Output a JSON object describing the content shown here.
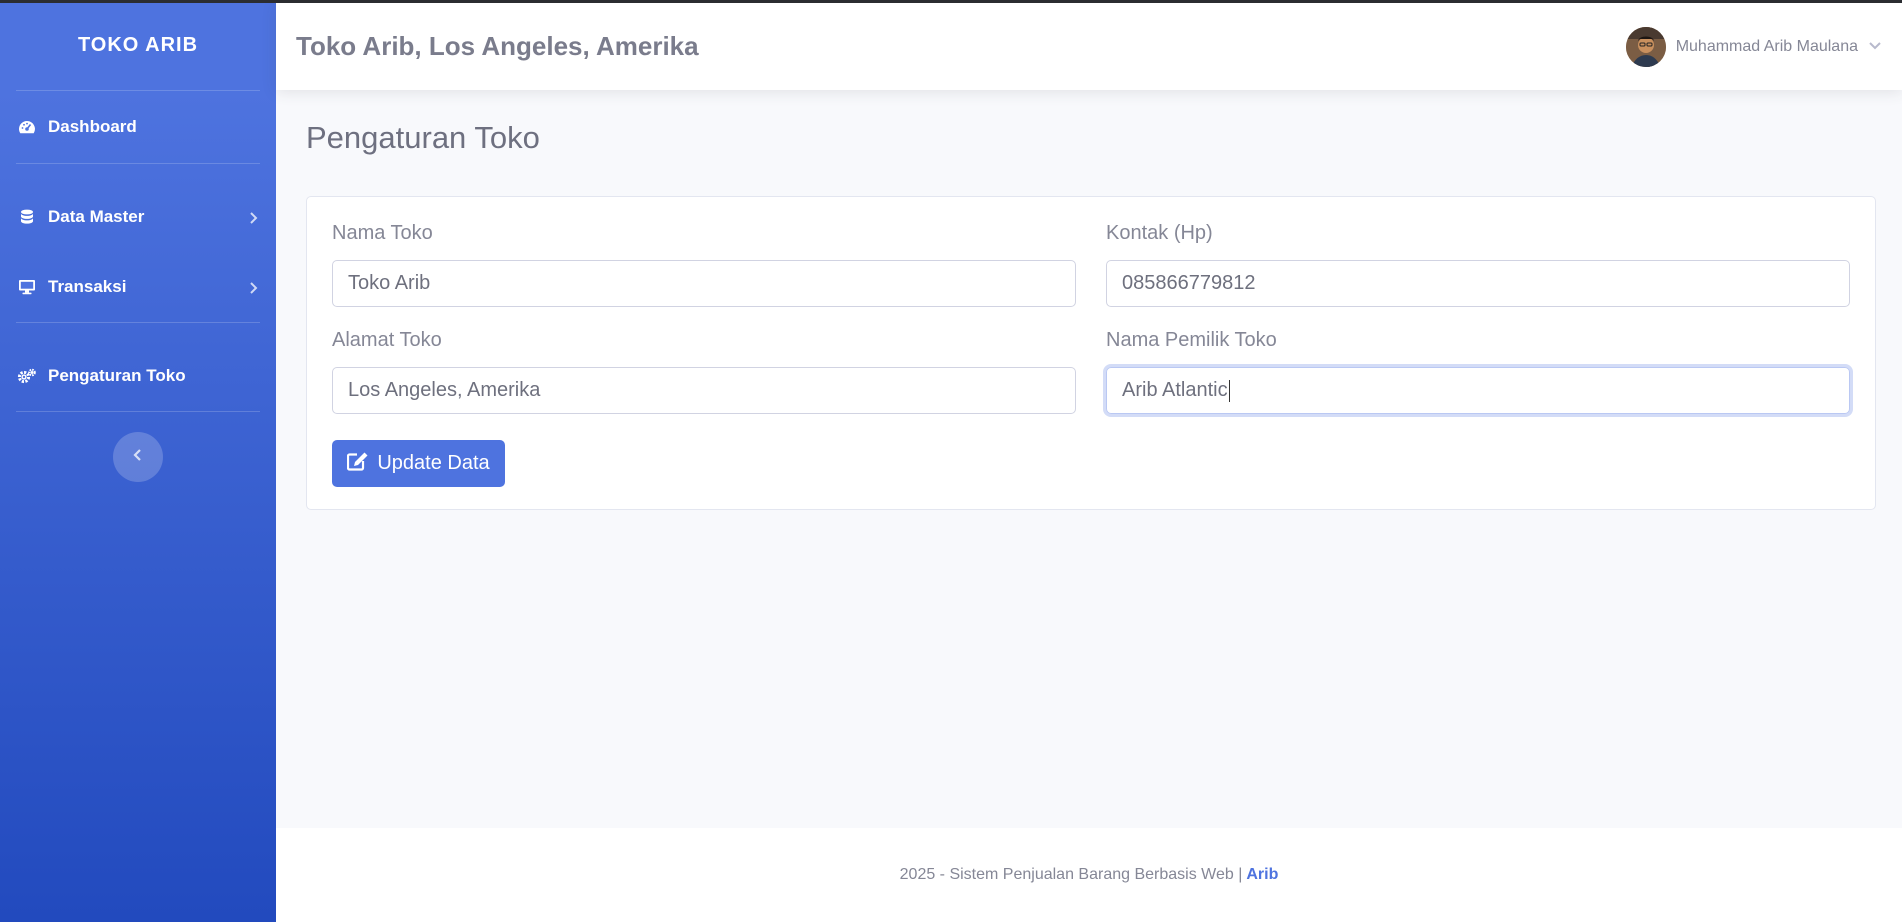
{
  "sidebar": {
    "brand": "TOKO ARIB",
    "items": [
      {
        "label": "Dashboard",
        "icon": "tachometer-icon"
      },
      {
        "label": "Data Master",
        "icon": "database-icon"
      },
      {
        "label": "Transaksi",
        "icon": "desktop-icon"
      },
      {
        "label": "Pengaturan Toko",
        "icon": "cogs-icon"
      }
    ],
    "toggle_icon": "chevron-left-icon"
  },
  "topbar": {
    "title": "Toko Arib, Los Angeles, Amerika",
    "user_name": "Muhammad Arib Maulana"
  },
  "page": {
    "title": "Pengaturan Toko"
  },
  "form": {
    "nama_toko": {
      "label": "Nama Toko",
      "value": "Toko Arib"
    },
    "kontak": {
      "label": "Kontak (Hp)",
      "value": "085866779812"
    },
    "alamat": {
      "label": "Alamat Toko",
      "value": "Los Angeles, Amerika"
    },
    "pemilik": {
      "label": "Nama Pemilik Toko",
      "value": "Arib Atlantic"
    },
    "submit_label": "Update Data"
  },
  "footer": {
    "text": "2025 - Sistem Penjualan Barang Berbasis Web |",
    "author": "Arib"
  },
  "colors": {
    "primary": "#4e73df",
    "primary_dark": "#224abe",
    "text_muted": "#858796"
  }
}
